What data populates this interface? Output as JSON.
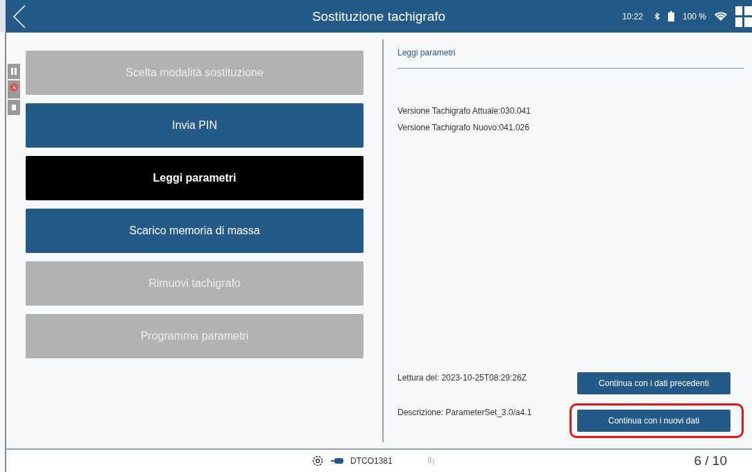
{
  "header": {
    "title": "Sostituzione tachigrafo",
    "time": "10:22",
    "battery": "100 %"
  },
  "steps": [
    {
      "label": "Scelta modalità sostituzione",
      "disabled": true,
      "selected": false
    },
    {
      "label": "Invia PIN",
      "disabled": false,
      "selected": false
    },
    {
      "label": "Leggi parametri",
      "disabled": false,
      "selected": true
    },
    {
      "label": "Scarico memoria di massa",
      "disabled": false,
      "selected": false
    },
    {
      "label": "Rimuovi tachigrafo",
      "disabled": true,
      "selected": false
    },
    {
      "label": "Programma parametri",
      "disabled": true,
      "selected": false
    }
  ],
  "detail": {
    "title": "Leggi parametri",
    "lines": [
      "Versione Tachigrafo Attuale:030.041",
      "Versione Tachigrafo Nuovo:041.026"
    ],
    "reading_date": "Lettura del: 2023-10-25T08:29:26Z",
    "description": "Descrizione: ParameterSet_3.0/a4.1",
    "buttons": [
      {
        "label": "Continua con i dati precedenti",
        "highlighted": false
      },
      {
        "label": "Continua con i nuovi dati",
        "highlighted": true
      }
    ]
  },
  "footer": {
    "device": "DTCO1381",
    "page": "6 / 10"
  }
}
